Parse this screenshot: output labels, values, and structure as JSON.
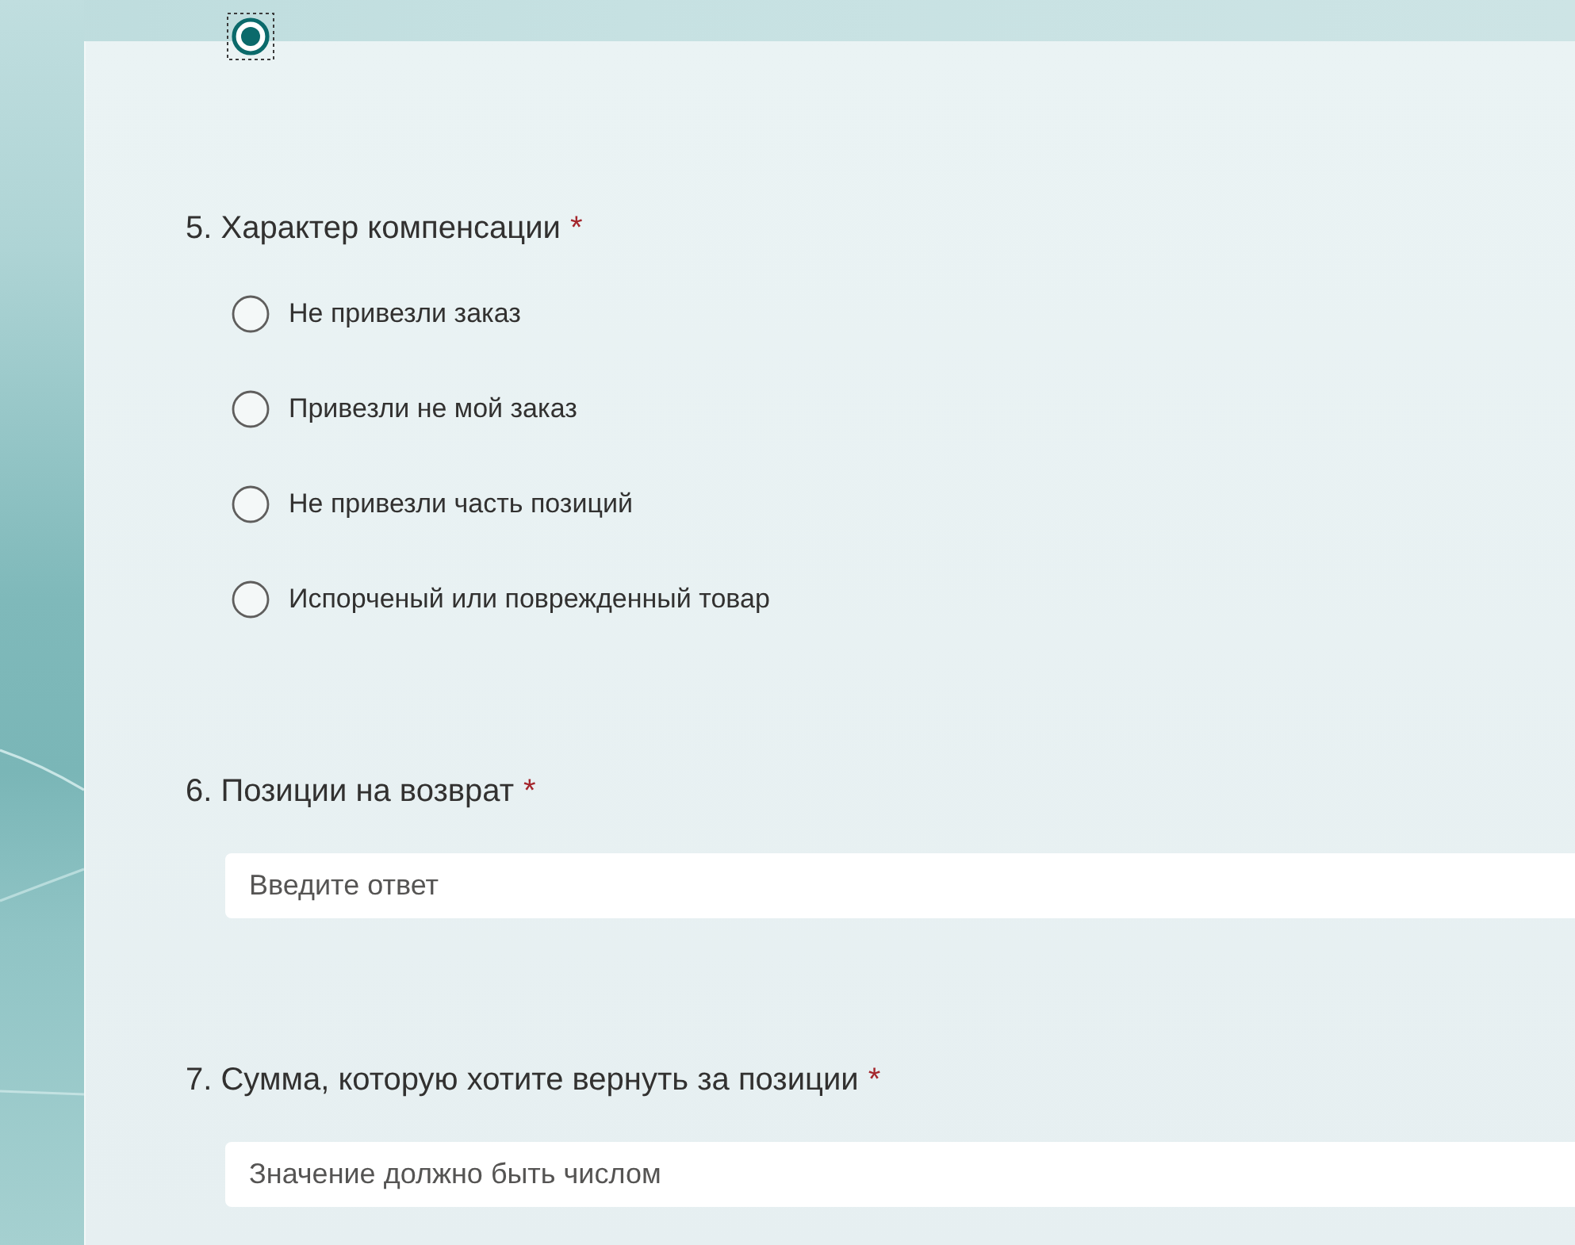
{
  "questions": [
    {
      "kind": "choice",
      "options": [
        {
          "selected": true,
          "focused": true
        }
      ]
    },
    {
      "kind": "choice",
      "title": "5. Характер компенсации",
      "required_mark": "*",
      "options": [
        {
          "label": "Не привезли заказ",
          "selected": false,
          "focused": false
        },
        {
          "label": "Привезли не мой заказ",
          "selected": false,
          "focused": false
        },
        {
          "label": "Не привезли часть позиций",
          "selected": false,
          "focused": false
        },
        {
          "label": "Испорченый или поврежденный товар",
          "selected": false,
          "focused": false
        }
      ]
    },
    {
      "kind": "text",
      "title": "6. Позиции на возврат",
      "required_mark": "*",
      "placeholder": "Введите ответ"
    },
    {
      "kind": "text",
      "title": "7. Сумма, которую хотите вернуть за позиции",
      "required_mark": "*",
      "placeholder": "Значение должно быть числом"
    }
  ]
}
